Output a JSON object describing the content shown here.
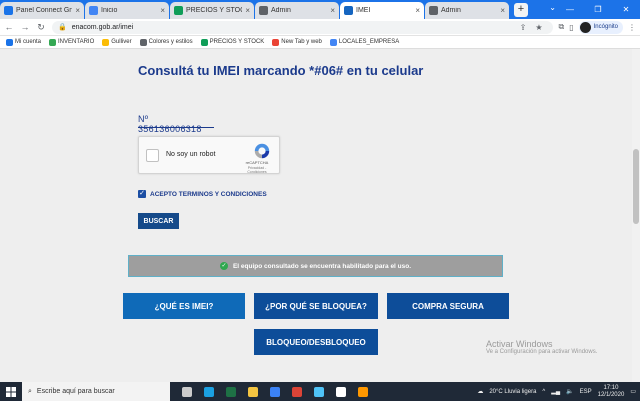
{
  "browser": {
    "tabs": [
      {
        "title": "Panel Connect Gnd",
        "color": "#1a73e8",
        "active": false
      },
      {
        "title": "Inicio",
        "color": "#4285f4",
        "active": false
      },
      {
        "title": "PRECIOS Y STOCK GN",
        "color": "#0f9d58",
        "active": false
      },
      {
        "title": "Admin",
        "color": "#5f6368",
        "active": false
      },
      {
        "title": "IMEI",
        "color": "#1565c0",
        "active": true
      },
      {
        "title": "Admin",
        "color": "#5f6368",
        "active": false
      }
    ],
    "new_tab": "+",
    "url": "enacom.gob.ar/imei",
    "profile_label": "Incógnito"
  },
  "bookmarks": [
    {
      "label": "Mi cuenta",
      "color": "#1a73e8"
    },
    {
      "label": "INVENTARIO",
      "color": "#34a853"
    },
    {
      "label": "Gulliver",
      "color": "#fbbc05"
    },
    {
      "label": "Colores y estilos",
      "color": "#5f6368"
    },
    {
      "label": "PRECIOS Y STOCK",
      "color": "#0f9d58"
    },
    {
      "label": "New Tab y web",
      "color": "#ea4335"
    },
    {
      "label": "LOCALES_EMPRESA",
      "color": "#4285f4"
    }
  ],
  "page": {
    "heading": "Consultá tu IMEI marcando *#06# en tu celular",
    "imei_value": "Nº 356136006318",
    "captcha": {
      "label": "No soy un robot",
      "brand": "reCAPTCHA",
      "terms": "Privacidad - Condiciones"
    },
    "accept_label": "ACEPTO TERMINOS Y CONDICIONES",
    "search_button": "BUSCAR",
    "result_message": "El equipo consultado se encuentra habilitado para el uso.",
    "buttons": {
      "what_is": "¿QUÉ ES IMEI?",
      "why_blocked": "¿POR QUÉ SE BLOQUEA?",
      "safe_buy": "COMPRA SEGURA",
      "block_unblock": "BLOQUEO/DESBLOQUEO"
    },
    "watermark": {
      "line1": "Activar Windows",
      "line2": "Ve a Configuración para activar Windows."
    }
  },
  "taskbar": {
    "search_placeholder": "Escribe aquí para buscar",
    "weather": "20°C Lluvia ligera",
    "language": "ESP",
    "time": "17:10",
    "date": "12/1/2020",
    "apps": [
      {
        "name": "task-view-icon",
        "color": "#cccccc"
      },
      {
        "name": "edge-icon",
        "color": "#1ba1e2"
      },
      {
        "name": "excel-icon",
        "color": "#1e7145"
      },
      {
        "name": "file-explorer-icon",
        "color": "#f4c542"
      },
      {
        "name": "store-icon",
        "color": "#3b82f6"
      },
      {
        "name": "chrome-icon",
        "color": "#db4437"
      },
      {
        "name": "photos-icon",
        "color": "#4fc3f7"
      },
      {
        "name": "mail-icon",
        "color": "#ffffff"
      },
      {
        "name": "app-icon",
        "color": "#ff9800"
      }
    ]
  }
}
